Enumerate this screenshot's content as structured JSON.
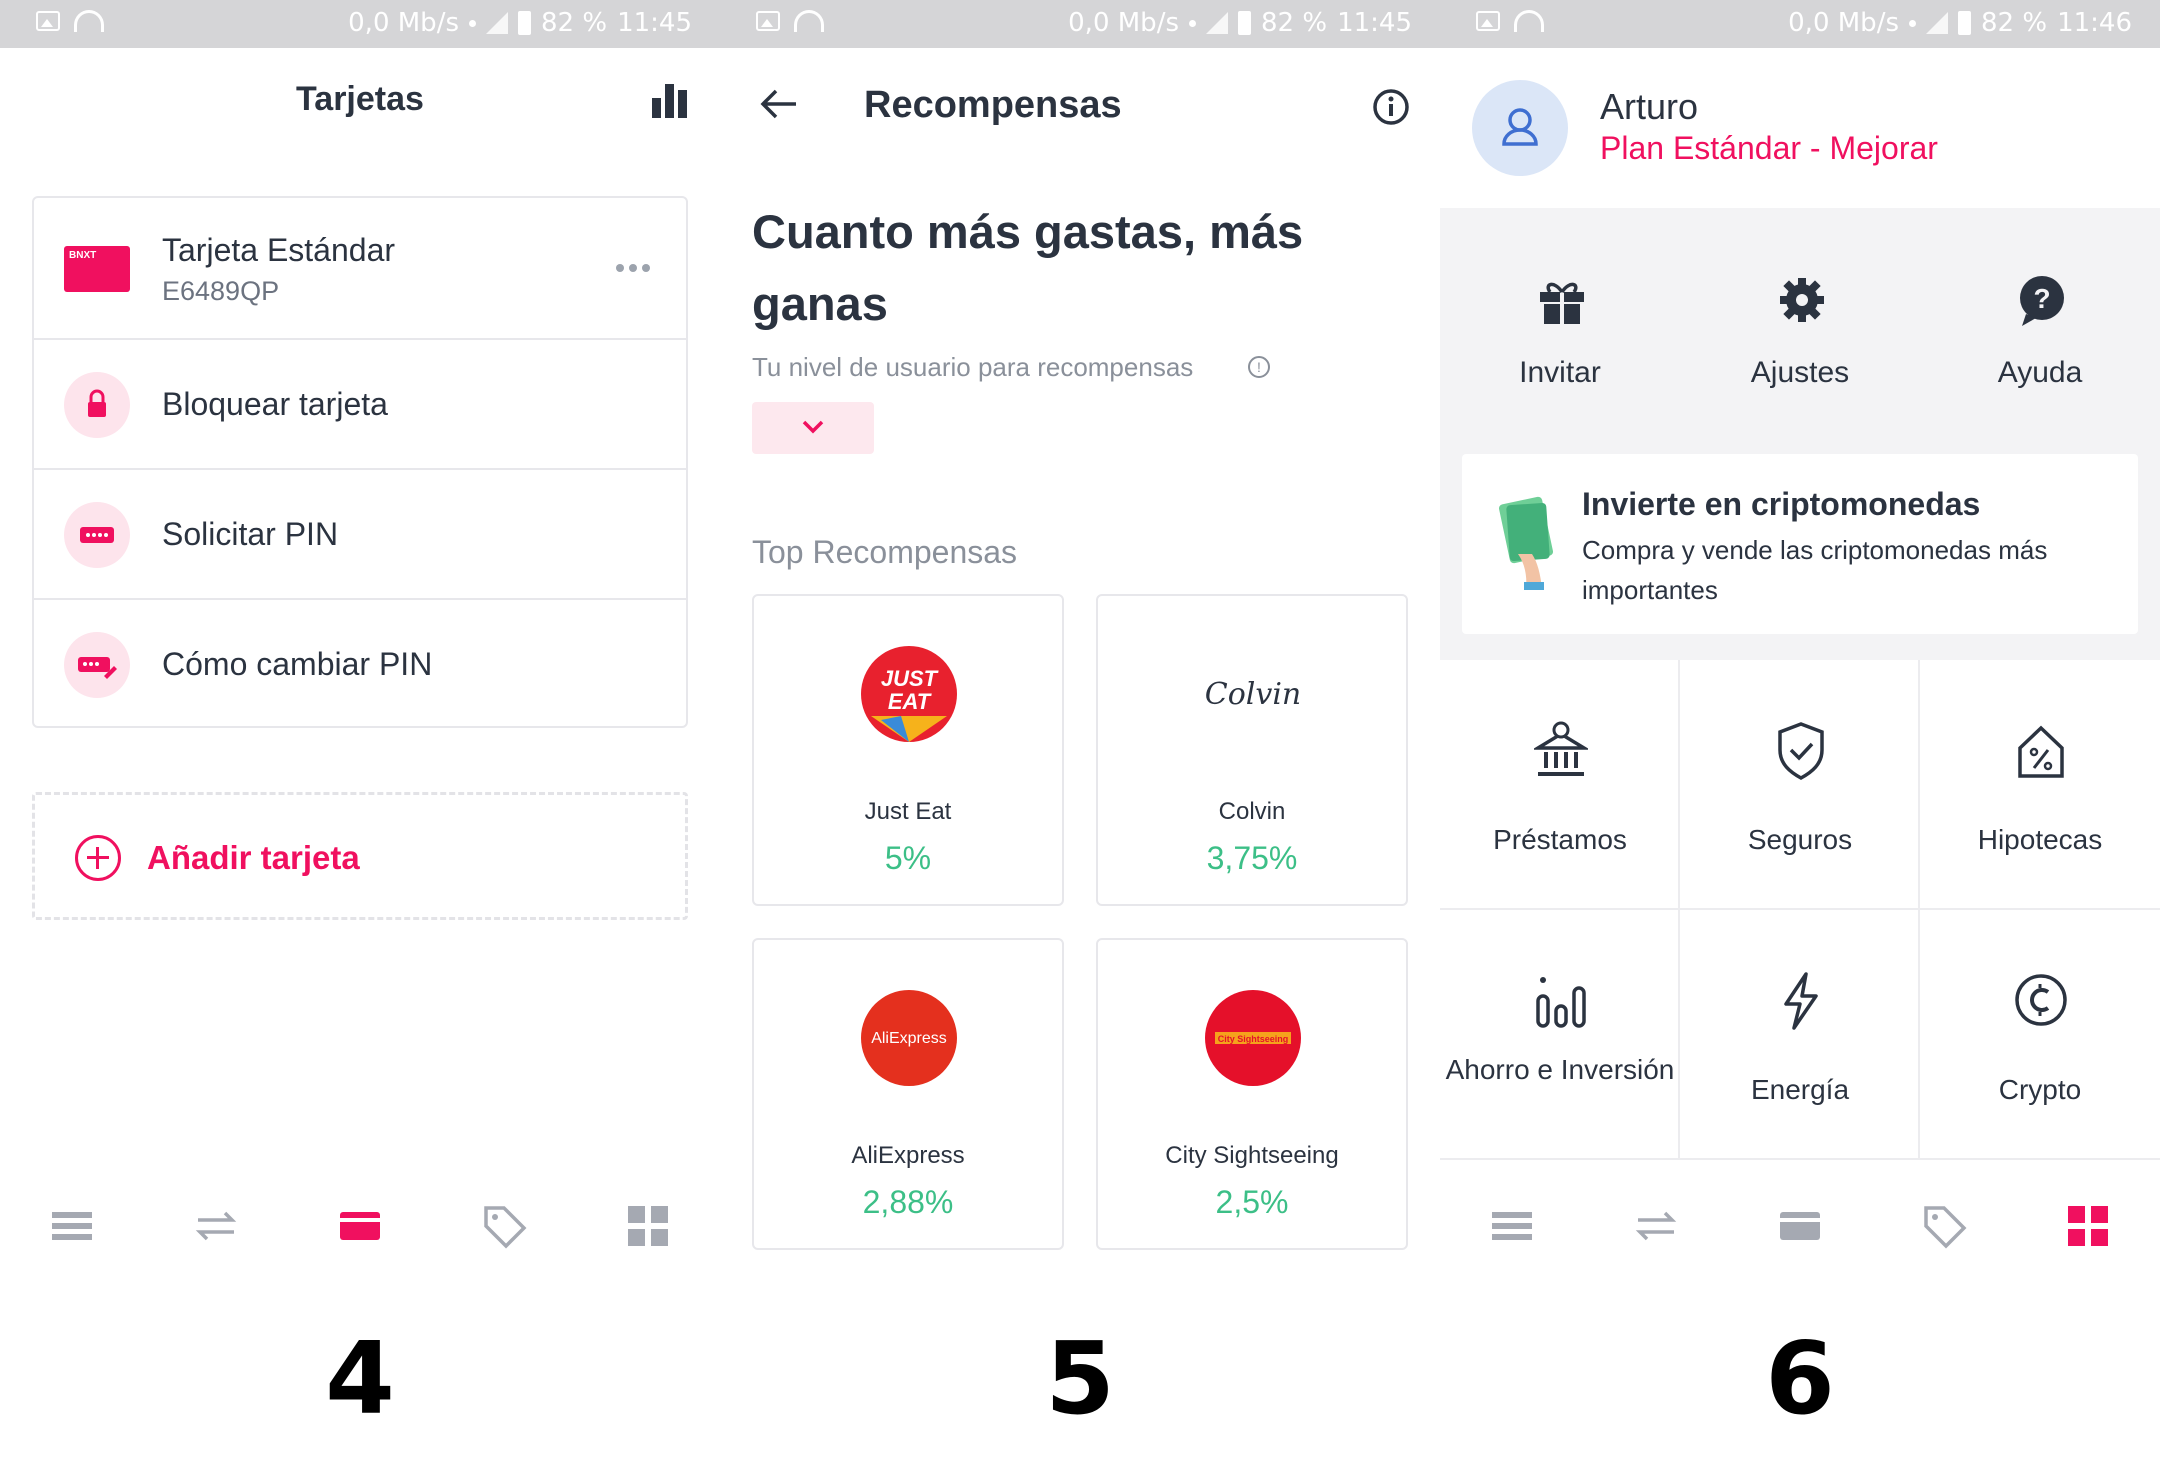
{
  "status_bars": [
    {
      "speed": "0,0 Mb/s",
      "battery": "82 %",
      "time": "11:45"
    },
    {
      "speed": "0,0 Mb/s",
      "battery": "82 %",
      "time": "11:45"
    },
    {
      "speed": "0,0 Mb/s",
      "battery": "82 %",
      "time": "11:46"
    }
  ],
  "screen4": {
    "title": "Tarjetas",
    "card": {
      "name": "Tarjeta Estándar",
      "number": "E6489QP",
      "thumb_text": "BNXT"
    },
    "actions": [
      "Bloquear tarjeta",
      "Solicitar PIN",
      "Cómo cambiar PIN"
    ],
    "add_card": "Añadir tarjeta",
    "step": "4"
  },
  "screen5": {
    "title": "Recompensas",
    "headline": "Cuanto más gastas, más ganas",
    "level_label": "Tu nivel de usuario para recompensas",
    "top_label": "Top Recompensas",
    "rewards": [
      {
        "name": "Just Eat",
        "pct": "5%",
        "logo_text": "JUST EAT"
      },
      {
        "name": "Colvin",
        "pct": "3,75%",
        "logo_text": "Colvin"
      },
      {
        "name": "AliExpress",
        "pct": "2,88%",
        "logo_text": "AliExpress"
      },
      {
        "name": "City Sightseeing",
        "pct": "2,5%",
        "logo_text": "City Sightseeing"
      }
    ],
    "step": "5"
  },
  "screen6": {
    "user_name": "Arturo",
    "plan": "Plan Estándar - Mejorar",
    "quick": [
      "Invitar",
      "Ajustes",
      "Ayuda"
    ],
    "promo": {
      "title": "Invierte en criptomonedas",
      "body": "Compra y vende las criptomonedas más importantes"
    },
    "products": [
      "Préstamos",
      "Seguros",
      "Hipotecas",
      "Ahorro e Inversión",
      "Energía",
      "Crypto"
    ],
    "step": "6"
  },
  "colors": {
    "accent": "#f0105f",
    "positive": "#3cbf87",
    "text": "#2b3340",
    "muted": "#8a909a"
  }
}
